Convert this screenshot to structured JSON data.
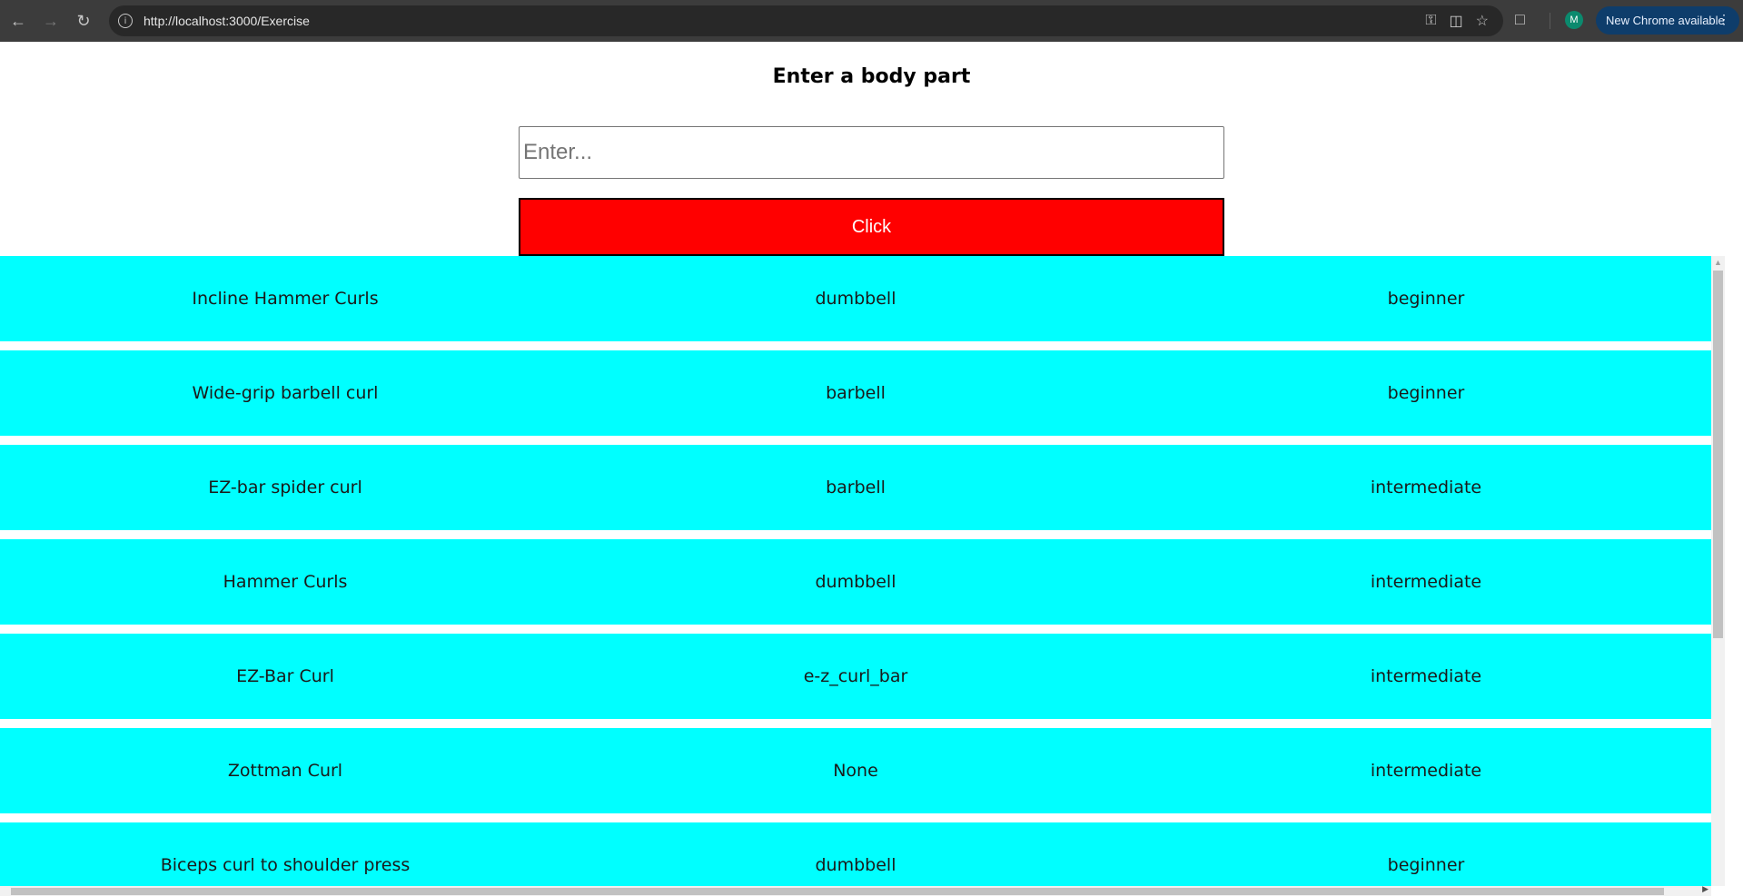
{
  "browser": {
    "url": "http://localhost:3000/Exercise",
    "update_label": "New Chrome available",
    "avatar_initial": "M"
  },
  "page": {
    "title": "Enter a body part",
    "input_placeholder": "Enter...",
    "input_value": "",
    "button_label": "Click",
    "colors": {
      "button": "#ff0000",
      "row": "#00ffff"
    }
  },
  "results": [
    {
      "name": "Incline Hammer Curls",
      "equipment": "dumbbell",
      "difficulty": "beginner"
    },
    {
      "name": "Wide-grip barbell curl",
      "equipment": "barbell",
      "difficulty": "beginner"
    },
    {
      "name": "EZ-bar spider curl",
      "equipment": "barbell",
      "difficulty": "intermediate"
    },
    {
      "name": "Hammer Curls",
      "equipment": "dumbbell",
      "difficulty": "intermediate"
    },
    {
      "name": "EZ-Bar Curl",
      "equipment": "e-z_curl_bar",
      "difficulty": "intermediate"
    },
    {
      "name": "Zottman Curl",
      "equipment": "None",
      "difficulty": "intermediate"
    },
    {
      "name": "Biceps curl to shoulder press",
      "equipment": "dumbbell",
      "difficulty": "beginner"
    }
  ]
}
